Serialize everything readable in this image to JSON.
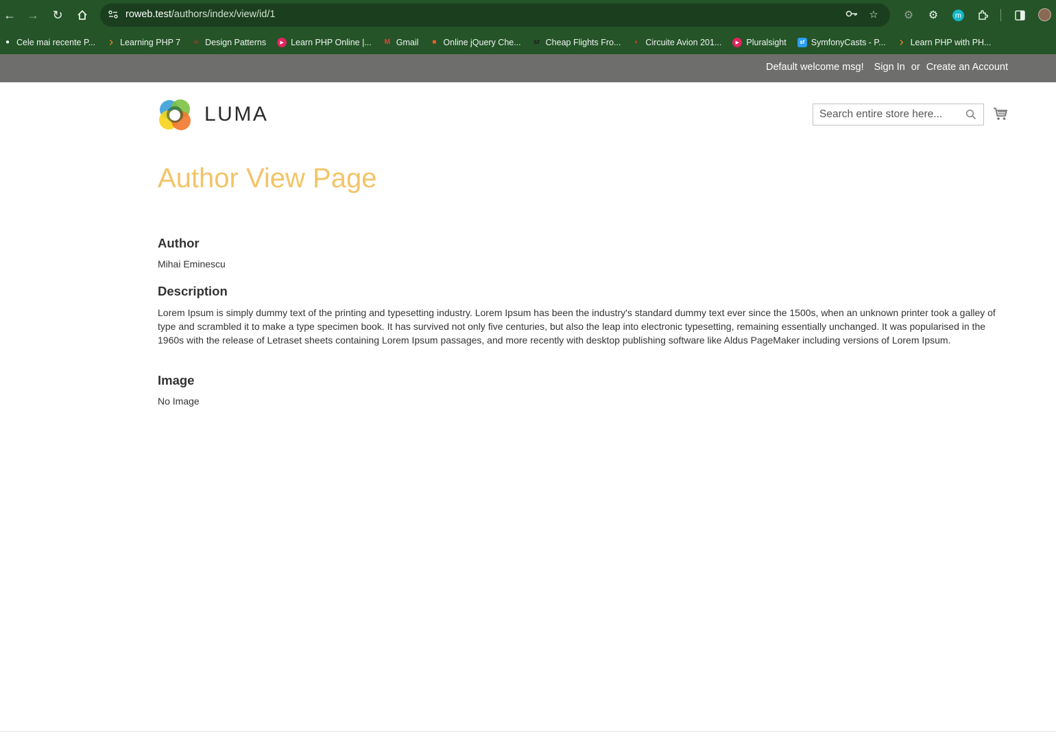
{
  "browser": {
    "url_host": "roweb.test",
    "url_path": "/authors/index/view/id/1",
    "bookmarks": [
      {
        "label": "Cele mai recente P...",
        "icon": "chat-bubble-icon",
        "color": "#ffffff"
      },
      {
        "label": "Learning PHP 7",
        "icon": "chevron-orange-icon",
        "color": "#f5821f"
      },
      {
        "label": "Design Patterns",
        "icon": "mascot-icon",
        "color": "#c0392b"
      },
      {
        "label": "Learn PHP Online |...",
        "icon": "play-circle-icon",
        "color": "#e0245e"
      },
      {
        "label": "Gmail",
        "icon": "gmail-icon",
        "color": "#ea4335"
      },
      {
        "label": "Online jQuery Che...",
        "icon": "gift-icon",
        "color": "#f05a28"
      },
      {
        "label": "Cheap Flights Fro...",
        "icon": "sr-logo-icon",
        "color": "#2a2a2a"
      },
      {
        "label": "Circuite Avion 201...",
        "icon": "swirl-icon",
        "color": "#e53935"
      },
      {
        "label": "Pluralsight",
        "icon": "play-circle-icon",
        "color": "#e0245e"
      },
      {
        "label": "SymfonyCasts - P...",
        "icon": "symfony-icon",
        "color": "#2a9df4"
      },
      {
        "label": "Learn PHP with PH...",
        "icon": "chevron-orange-icon",
        "color": "#f5821f"
      }
    ]
  },
  "header": {
    "welcome": "Default welcome msg!",
    "sign_in": "Sign In",
    "or": "or",
    "create_account": "Create an Account"
  },
  "logo": {
    "text": "LUMA"
  },
  "search": {
    "placeholder": "Search entire store here..."
  },
  "page": {
    "title": "Author View Page",
    "author_heading": "Author",
    "author_value": "Mihai Eminescu",
    "description_heading": "Description",
    "description_value": "Lorem Ipsum is simply dummy text of the printing and typesetting industry. Lorem Ipsum has been the industry's standard dummy text ever since the 1500s, when an unknown printer took a galley of type and scrambled it to make a type specimen book. It has survived not only five centuries, but also the leap into electronic typesetting, remaining essentially unchanged. It was popularised in the 1960s with the release of Letraset sheets containing Lorem Ipsum passages, and more recently with desktop publishing software like Aldus PageMaker including versions of Lorem Ipsum.",
    "image_heading": "Image",
    "image_value": "No Image"
  },
  "colors": {
    "browser_chrome": "#245428",
    "header_panel": "#6e6e6c",
    "title_accent": "#f2c468"
  }
}
